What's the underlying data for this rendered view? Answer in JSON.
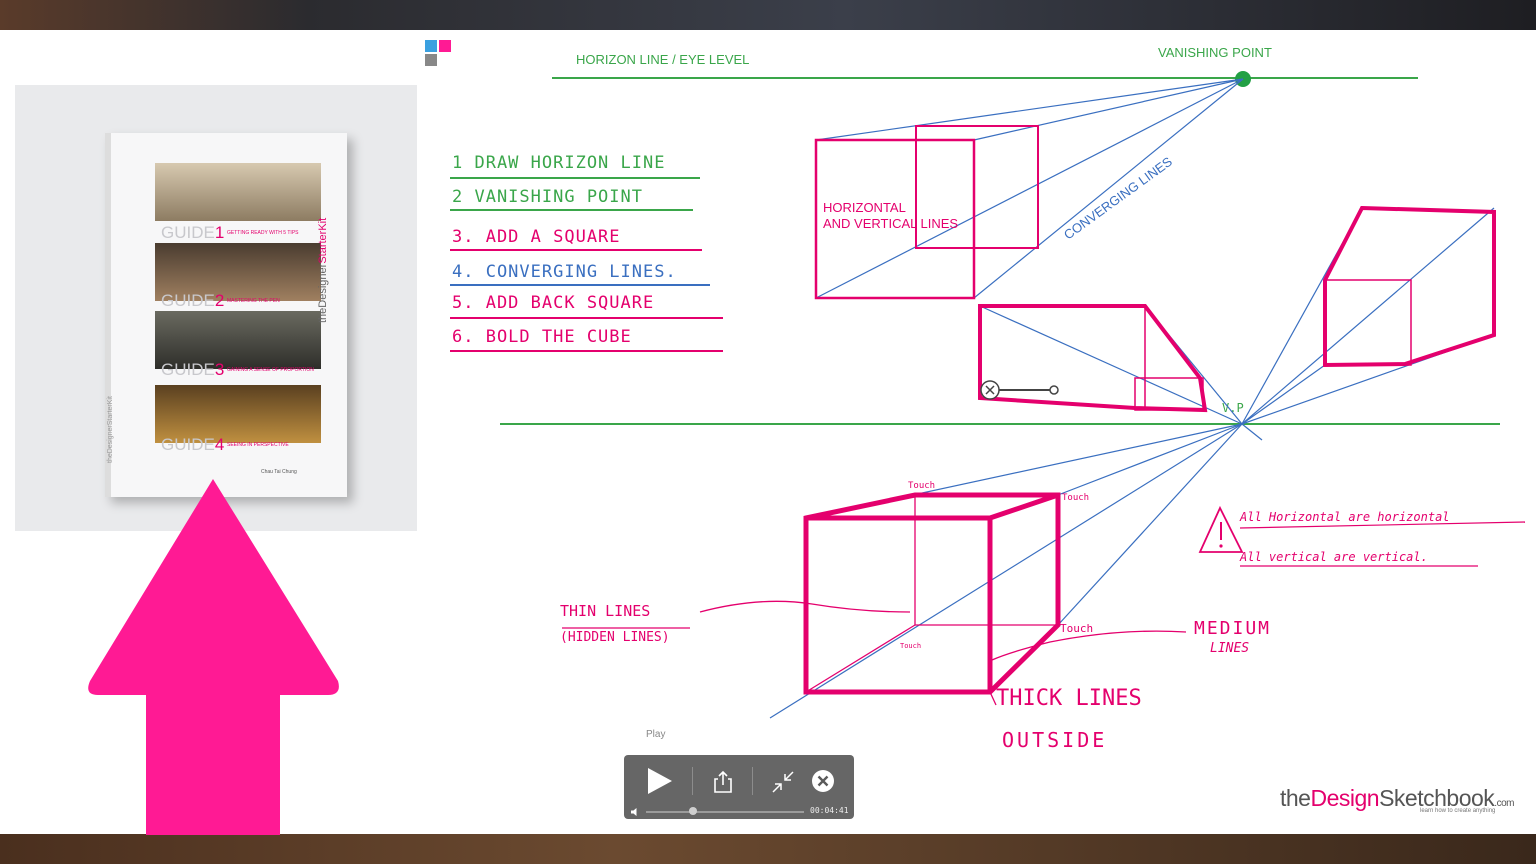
{
  "video": {
    "horizon_label": "HORIZON LINE / EYE LEVEL",
    "vanishing_label": "VANISHING POINT",
    "steps": [
      "1 DRAW HORIZON LINE",
      "2 VANISHING POINT",
      "3. ADD A SQUARE",
      "4. CONVERGING LINES.",
      "5. ADD BACK SQUARE",
      "6. BOLD THE CUBE"
    ],
    "hv_label_1": "HORIZONTAL",
    "hv_label_2": "AND VERTICAL LINES",
    "converging_label": "CONVERGING LINES",
    "vp_mark": "V.P",
    "note_horizontal": "All Horizontal are horizontal",
    "note_vertical": "All vertical are vertical.",
    "thin_lines": "THIN LINES",
    "hidden_lines": "(HIDDEN LINES)",
    "medium": "MEDIUM",
    "medium_2": "LINES",
    "thick": "THICK LINES",
    "outside": "OUTSIDE",
    "touch": "Touch",
    "brand_the": "the",
    "brand_design": "Design",
    "brand_sketch": "Sketchbook",
    "brand_com": ".com",
    "brand_tag": "learn how to create anything"
  },
  "book": {
    "guides": [
      {
        "num": "1",
        "title": "GETTING READY WITH 5 TIPS"
      },
      {
        "num": "2",
        "title": "MASTERING THE PEN"
      },
      {
        "num": "3",
        "title": "GAINING A SENSE OF PROPORTION"
      },
      {
        "num": "4",
        "title": "SEEING IN PERSPECTIVE"
      }
    ],
    "guide_word": "GUIDE",
    "spine_title_1": "theDesigner",
    "spine_title_2": "StarterKit",
    "left_title": "theDesignerStarterKit",
    "author": "Chau Tai Chung"
  },
  "player": {
    "tooltip": "Play",
    "time": "00:04:41",
    "progress_fraction": 0.3
  },
  "colors": {
    "pink": "#e4006d",
    "green": "#3aa64a",
    "blue": "#3a6fc0"
  }
}
